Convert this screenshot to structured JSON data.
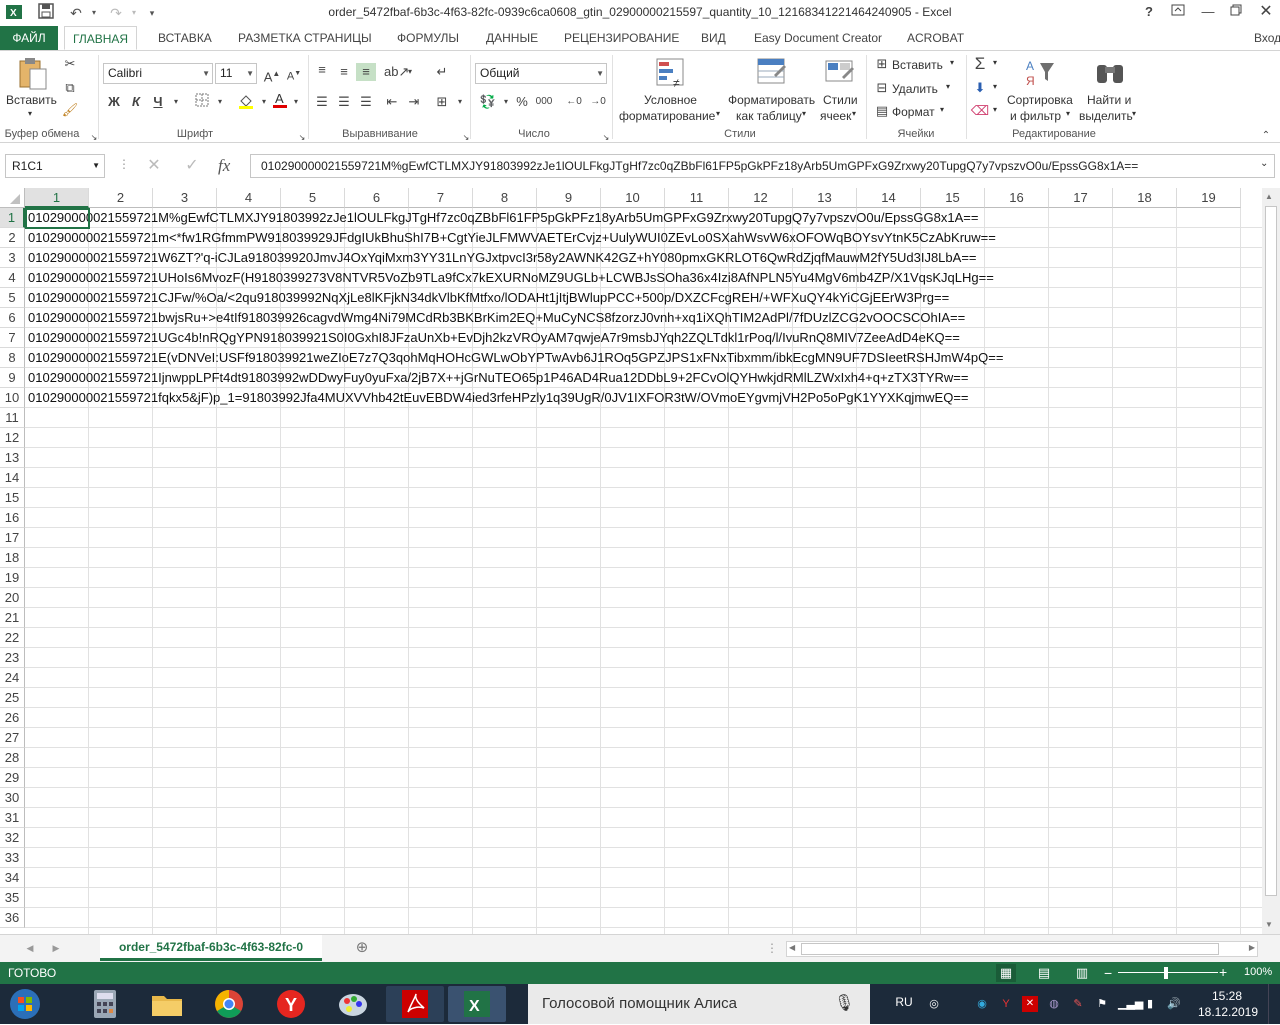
{
  "window": {
    "title": "order_5472fbaf-6b3c-4f63-82fc-0939c6ca0608_gtin_02900000215597_quantity_10_12168341221464240905 - Excel",
    "help": "?",
    "controls": [
      "restore-ribbon",
      "minimize",
      "maximize",
      "close"
    ]
  },
  "ribbon_tabs": [
    "ФАЙЛ",
    "ГЛАВНАЯ",
    "ВСТАВКА",
    "РАЗМЕТКА СТРАНИЦЫ",
    "ФОРМУЛЫ",
    "ДАННЫЕ",
    "РЕЦЕНЗИРОВАНИЕ",
    "ВИД",
    "Easy Document Creator",
    "ACROBAT"
  ],
  "signin": "Вход",
  "ribbon": {
    "clipboard": {
      "paste": "Вставить",
      "label": "Буфер обмена"
    },
    "font": {
      "name": "Calibri",
      "size": "11",
      "bold": "Ж",
      "italic": "К",
      "underline": "Ч",
      "label": "Шрифт"
    },
    "alignment": {
      "label": "Выравнивание"
    },
    "number": {
      "format": "Общий",
      "label": "Число",
      "percent": "%",
      "thousands": "000"
    },
    "styles": {
      "conditional": [
        "Условное",
        "форматирование"
      ],
      "as_table": [
        "Форматировать",
        "как таблицу"
      ],
      "cell_styles": [
        "Стили",
        "ячеек"
      ],
      "label": "Стили"
    },
    "cells": {
      "insert": "Вставить",
      "delete": "Удалить",
      "format": "Формат",
      "label": "Ячейки"
    },
    "editing": {
      "sort": [
        "Сортировка",
        "и фильтр"
      ],
      "find": [
        "Найти и",
        "выделить"
      ],
      "label": "Редактирование"
    }
  },
  "formula_bar": {
    "name_box": "R1C1",
    "fx": "fx",
    "value": "010290000021559721M%gEwfCTLMXJY91803992zJe1lOULFkgJTgHf7zc0qZBbFl61FP5pGkPFz18yArb5UmGPFxG9Zrxwy20TupgQ7y7vpszvO0u/EpssGG8x1A=="
  },
  "columns": [
    "1",
    "2",
    "3",
    "4",
    "5",
    "6",
    "7",
    "8",
    "9",
    "10",
    "11",
    "12",
    "13",
    "14",
    "15",
    "16",
    "17",
    "18",
    "19"
  ],
  "rows": [
    "1",
    "2",
    "3",
    "4",
    "5",
    "6",
    "7",
    "8",
    "9",
    "10",
    "11",
    "12",
    "13",
    "14",
    "15",
    "16",
    "17",
    "18",
    "19",
    "20",
    "21",
    "22",
    "23",
    "24",
    "25",
    "26",
    "27",
    "28",
    "29",
    "30",
    "31",
    "32",
    "33",
    "34",
    "35",
    "36"
  ],
  "cells": [
    "010290000021559721M%gEwfCTLMXJY91803992zJe1lOULFkgJTgHf7zc0qZBbFl61FP5pGkPFz18yArb5UmGPFxG9Zrxwy20TupgQ7y7vpszvO0u/EpssGG8x1A==",
    "010290000021559721m<*fw1RGfmmPW918039929JFdgIUkBhuShI7B+CgtYieJLFMWVAETErCvjz+UulyWUI0ZEvLo0SXahWsvW6xOFOWqBOYsvYtnK5CzAbKruw==",
    "010290000021559721W6ZT?'q-iCJLa918039920JmvJ4OxYqiMxm3YY31LnYGJxtpvcI3r58y2AWNK42GZ+hY080pmxGKRLOT6QwRdZjqfMauwM2fY5Ud3IJ8LbA==",
    "010290000021559721UHoIs6MvozF(H9180399273V8NTVR5VoZb9TLa9fCx7kEXURNoMZ9UGLb+LCWBJsSOha36x4Izi8AfNPLN5Yu4MgV6mb4ZP/X1VqsKJqLHg==",
    "010290000021559721CJFw/%Oa/<2qu918039992NqXjLe8lKFjkN34dkVlbKfMtfxo/lODAHt1jItjBWlupPCC+500p/DXZCFcgREH/+WFXuQY4kYiCGjEErW3Prg==",
    "010290000021559721bwjsRu+>e4tIf918039926cagvdWmg4Ni79MCdRb3BKBrKim2EQ+MuCyNCS8fzorzJ0vnh+xq1iXQhTIM2AdPl/7fDUzlZCG2vOOCSCOhIA==",
    "010290000021559721UGc4b!nRQgYPN918039921S0I0GxhI8JFzaUnXb+EvDjh2kzVROyAM7qwjeA7r9msbJYqh2ZQLTdkl1rPoq/l/IvuRnQ8MIV7ZeeAdD4eKQ==",
    "010290000021559721E(vDNVeI:USFf918039921weZIoE7z7Q3qohMqHOHcGWLwObYPTwAvb6J1ROq5GPZJPS1xFNxTibxmm/ibkEcgMN9UF7DSIeetRSHJmW4pQ==",
    "010290000021559721IjnwppLPFt4dt91803992wDDwyFuy0yuFxa/2jB7X++jGrNuTEO65p1P46AD4Rua12DDbL9+2FCvOlQYHwkjdRMlLZWxIxh4+q+zTX3TYRw==",
    "010290000021559721fqkx5&jF)p_1=91803992Jfa4MUXVVhb42tEuvEBDW4ied3rfeHPzly1q39UgR/0JV1IXFOR3tW/OVmoEYgvmjVH2Po5oPgK1YYXKqjmwEQ=="
  ],
  "sheet_tab": "order_5472fbaf-6b3c-4f63-82fc-0",
  "status": {
    "ready": "ГОТОВО",
    "zoom": "100%"
  },
  "taskbar": {
    "alisa": "Голосовой помощник Алиса",
    "lang": "RU",
    "time": "15:28",
    "date": "18.12.2019"
  },
  "colors": {
    "excel_green": "#217346",
    "taskbar": "#1c2a3a"
  }
}
